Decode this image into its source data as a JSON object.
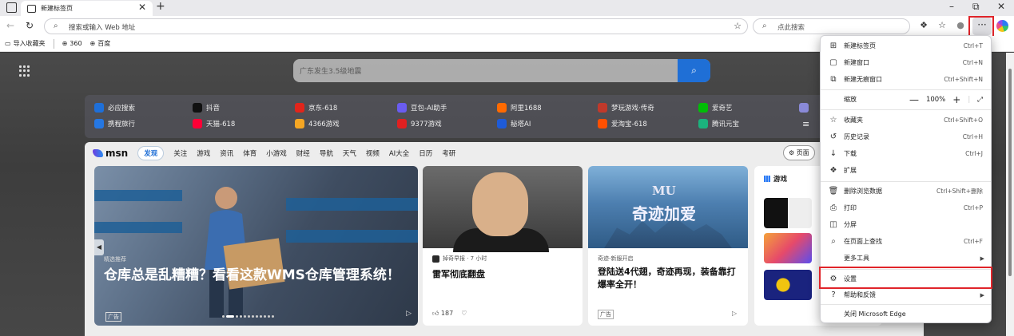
{
  "tab": {
    "title": "新建标签页"
  },
  "address_bar": {
    "placeholder": "搜索或输入 Web 地址"
  },
  "search_box": {
    "placeholder": "点此搜索"
  },
  "favorites": [
    {
      "label": "导入收藏夹"
    },
    {
      "label": "360"
    },
    {
      "label": "百度"
    }
  ],
  "ntp_search": {
    "placeholder": "广东发生3.5级地震"
  },
  "quick_links": [
    {
      "label": "必应搜索",
      "color": "#1e6fd9"
    },
    {
      "label": "抖音",
      "color": "#111111"
    },
    {
      "label": "京东-618",
      "color": "#e1251b"
    },
    {
      "label": "豆包-AI助手",
      "color": "#6a5cf0"
    },
    {
      "label": "阿里1688",
      "color": "#ff6a00"
    },
    {
      "label": "梦玩游戏·传奇",
      "color": "#c0392b"
    },
    {
      "label": "爱奇艺",
      "color": "#00be06"
    },
    {
      "label": "携程旅行",
      "color": "#2577e3"
    },
    {
      "label": "天猫-618",
      "color": "#ff0036"
    },
    {
      "label": "4366游戏",
      "color": "#f5a623"
    },
    {
      "label": "9377游戏",
      "color": "#e02020"
    },
    {
      "label": "秘塔AI",
      "color": "#1e5bd8"
    },
    {
      "label": "爱淘宝-618",
      "color": "#ff5000"
    },
    {
      "label": "腾讯元宝",
      "color": "#1bb27d"
    }
  ],
  "feed_nav": {
    "logo": "msn",
    "tabs": [
      "发现",
      "关注",
      "游戏",
      "资讯",
      "体育",
      "小游戏",
      "财经",
      "导航",
      "天气",
      "视频",
      "AI大全",
      "日历",
      "考研"
    ],
    "right_pill": "页面"
  },
  "hero_card": {
    "tag": "精选推荐",
    "headline": "仓库总是乱糟糟？看看这款WMS仓库管理系统！",
    "ad": "广告"
  },
  "news_card": {
    "source": "掉奇早报 · 7 小时",
    "title": "雷军彻底翻盘",
    "likes": "187"
  },
  "game_card": {
    "logo_small": "MU",
    "logo_big": "奇迹加爱",
    "source": "奇迹-新服开启",
    "title": "登陆送4代翅，奇迹再现，装备靠打爆率全开！",
    "ad": "广告"
  },
  "games_panel": {
    "header": "游戏"
  },
  "menu": {
    "items": [
      {
        "icon": "new-tab-icon",
        "glyph": "⊞",
        "label": "新建标签页",
        "shortcut": "Ctrl+T"
      },
      {
        "icon": "new-window-icon",
        "glyph": "▢",
        "label": "新建窗口",
        "shortcut": "Ctrl+N"
      },
      {
        "icon": "inprivate-window-icon",
        "glyph": "⧉",
        "label": "新建无痕窗口",
        "shortcut": "Ctrl+Shift+N"
      },
      {
        "icon": "favorites-icon",
        "glyph": "☆",
        "label": "收藏夹",
        "shortcut": "Ctrl+Shift+O"
      },
      {
        "icon": "history-icon",
        "glyph": "↺",
        "label": "历史记录",
        "shortcut": "Ctrl+H"
      },
      {
        "icon": "download-icon",
        "glyph": "↓",
        "label": "下载",
        "shortcut": "Ctrl+J"
      },
      {
        "icon": "extensions-icon",
        "glyph": "❖",
        "label": "扩展",
        "shortcut": ""
      },
      {
        "icon": "delete-data-icon",
        "glyph": "🗑",
        "label": "删除浏览数据",
        "shortcut": "Ctrl+Shift+删除"
      },
      {
        "icon": "print-icon",
        "glyph": "⎙",
        "label": "打印",
        "shortcut": "Ctrl+P"
      },
      {
        "icon": "split-screen-icon",
        "glyph": "◫",
        "label": "分屏",
        "shortcut": ""
      },
      {
        "icon": "find-on-page-icon",
        "glyph": "⌕",
        "label": "在页面上查找",
        "shortcut": "Ctrl+F"
      },
      {
        "icon": "",
        "glyph": "",
        "label": "更多工具",
        "shortcut": ""
      },
      {
        "icon": "settings-icon",
        "glyph": "⚙",
        "label": "设置",
        "shortcut": ""
      },
      {
        "icon": "help-icon",
        "glyph": "?",
        "label": "帮助和反馈",
        "shortcut": ""
      },
      {
        "icon": "",
        "glyph": "",
        "label": "关闭 Microsoft Edge",
        "shortcut": ""
      }
    ],
    "zoom": {
      "label": "缩放",
      "value": "100%"
    }
  },
  "colors": {
    "highlight": "#e0242a",
    "accent": "#1f6fd6"
  }
}
